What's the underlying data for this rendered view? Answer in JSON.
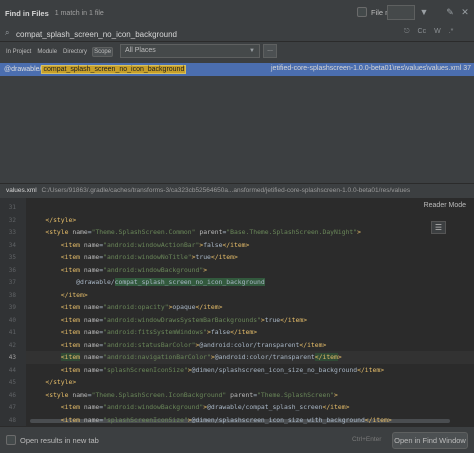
{
  "dialog": {
    "title": "Find in Files",
    "match_count": "1 match in 1 file",
    "file_mask_label": "File mask:",
    "file_mask_value": ""
  },
  "search": {
    "query": "compat_splash_screen_no_icon_background",
    "options": [
      "Cc",
      "W",
      ".*"
    ]
  },
  "scope": {
    "tabs": [
      "In Project",
      "Module",
      "Directory",
      "Scope"
    ],
    "active_tab": "Scope",
    "selected": "All Places",
    "more_label": "..."
  },
  "results": [
    {
      "prefix": "@drawable/",
      "match": "compat_splash_screen_no_icon_background",
      "location": "jetified-core-splashscreen-1.0.0-beta01\\res\\values\\values.xml 37"
    }
  ],
  "preview": {
    "file_name": "values.xml",
    "file_path": "C:/Users/91863/.gradle/caches/transforms-3/ca323cb52564650a...ansformed/jetified-core-splashscreen-1.0.0-beta01/res/values",
    "reader_mode": "Reader Mode",
    "line_numbers": [
      "31",
      "32",
      "33",
      "34",
      "35",
      "36",
      "37",
      "38",
      "39",
      "40",
      "41",
      "42",
      "43",
      "44",
      "45",
      "46",
      "47",
      "48"
    ],
    "current_line": "43",
    "code_lines": [
      "",
      "    </style>",
      "    <style name=\"Theme.SplashScreen.Common\" parent=\"Base.Theme.SplashScreen.DayNight\">",
      "        <item name=\"android:windowActionBar\">false</item>",
      "        <item name=\"android:windowNoTitle\">true</item>",
      "        <item name=\"android:windowBackground\">",
      "            @drawable/compat_splash_screen_no_icon_background",
      "        </item>",
      "        <item name=\"android:opacity\">opaque</item>",
      "        <item name=\"android:windowDrawsSystemBarBackgrounds\">true</item>",
      "        <item name=\"android:fitsSystemWindows\">false</item>",
      "        <item name=\"android:statusBarColor\">@android:color/transparent</item>",
      "        <item name=\"android:navigationBarColor\">@android:color/transparent</item>",
      "        <item name=\"splashScreenIconSize\">@dimen/splashscreen_icon_size_no_background</item>",
      "    </style>",
      "    <style name=\"Theme.SplashScreen.IconBackground\" parent=\"Theme.SplashScreen\">",
      "        <item name=\"android:windowBackground\">@drawable/compat_splash_screen</item>",
      "        <item name=\"splashScreenIconSize\">@dimen/splashscreen_icon_size_with_background</item>"
    ]
  },
  "footer": {
    "open_in_new_tab": "Open results in new tab",
    "shortcut": "Ctrl+Enter",
    "find_window_button": "Open in Find Window"
  },
  "colors": {
    "accent": "#4b6eaf",
    "match_highlight": "#c8a02a",
    "tag": "#e8bf6a",
    "string_value": "#6a8759",
    "editor_bg": "#2b2b2b",
    "panel_bg": "#3c3f41"
  }
}
